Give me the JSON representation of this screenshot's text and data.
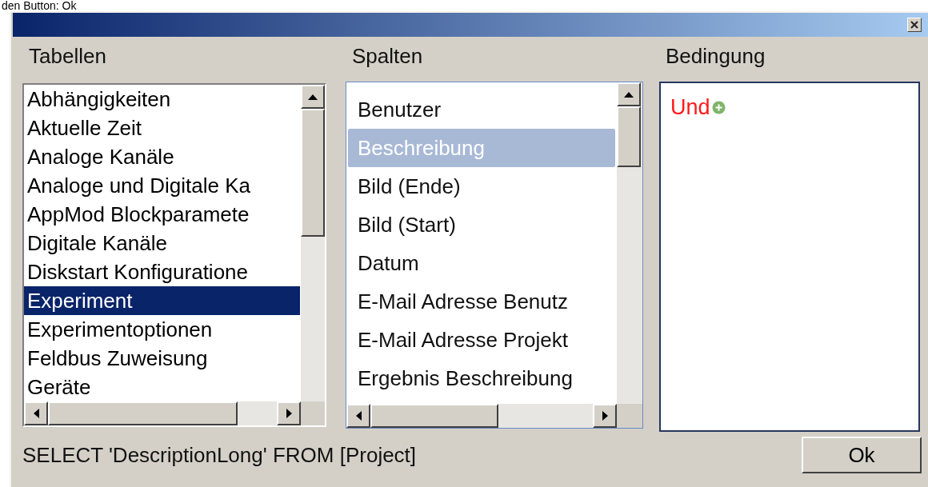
{
  "intro_text": "den Button: Ok",
  "tables": {
    "label": "Tabellen",
    "items": [
      {
        "text": "Abhängigkeiten",
        "selected": false
      },
      {
        "text": "Aktuelle Zeit",
        "selected": false
      },
      {
        "text": "Analoge Kanäle",
        "selected": false
      },
      {
        "text": "Analoge und Digitale Ka",
        "selected": false
      },
      {
        "text": "AppMod Blockparamete",
        "selected": false
      },
      {
        "text": "Digitale Kanäle",
        "selected": false
      },
      {
        "text": "Diskstart Konfiguratione",
        "selected": false
      },
      {
        "text": "Experiment",
        "selected": true
      },
      {
        "text": "Experimentoptionen",
        "selected": false
      },
      {
        "text": "Feldbus Zuweisung",
        "selected": false
      },
      {
        "text": "Geräte",
        "selected": false
      }
    ]
  },
  "columns": {
    "label": "Spalten",
    "items": [
      {
        "text": "Benutzer",
        "selected": false
      },
      {
        "text": "Beschreibung",
        "selected": true
      },
      {
        "text": "Bild (Ende)",
        "selected": false
      },
      {
        "text": "Bild (Start)",
        "selected": false
      },
      {
        "text": "Datum",
        "selected": false
      },
      {
        "text": "E-Mail Adresse Benutz",
        "selected": false
      },
      {
        "text": "E-Mail Adresse Projekt",
        "selected": false
      },
      {
        "text": "Ergebnis Beschreibung",
        "selected": false
      }
    ]
  },
  "condition": {
    "label": "Bedingung",
    "operator": "Und"
  },
  "sql_text": "SELECT 'DescriptionLong' FROM [Project]",
  "ok_button": "Ok"
}
